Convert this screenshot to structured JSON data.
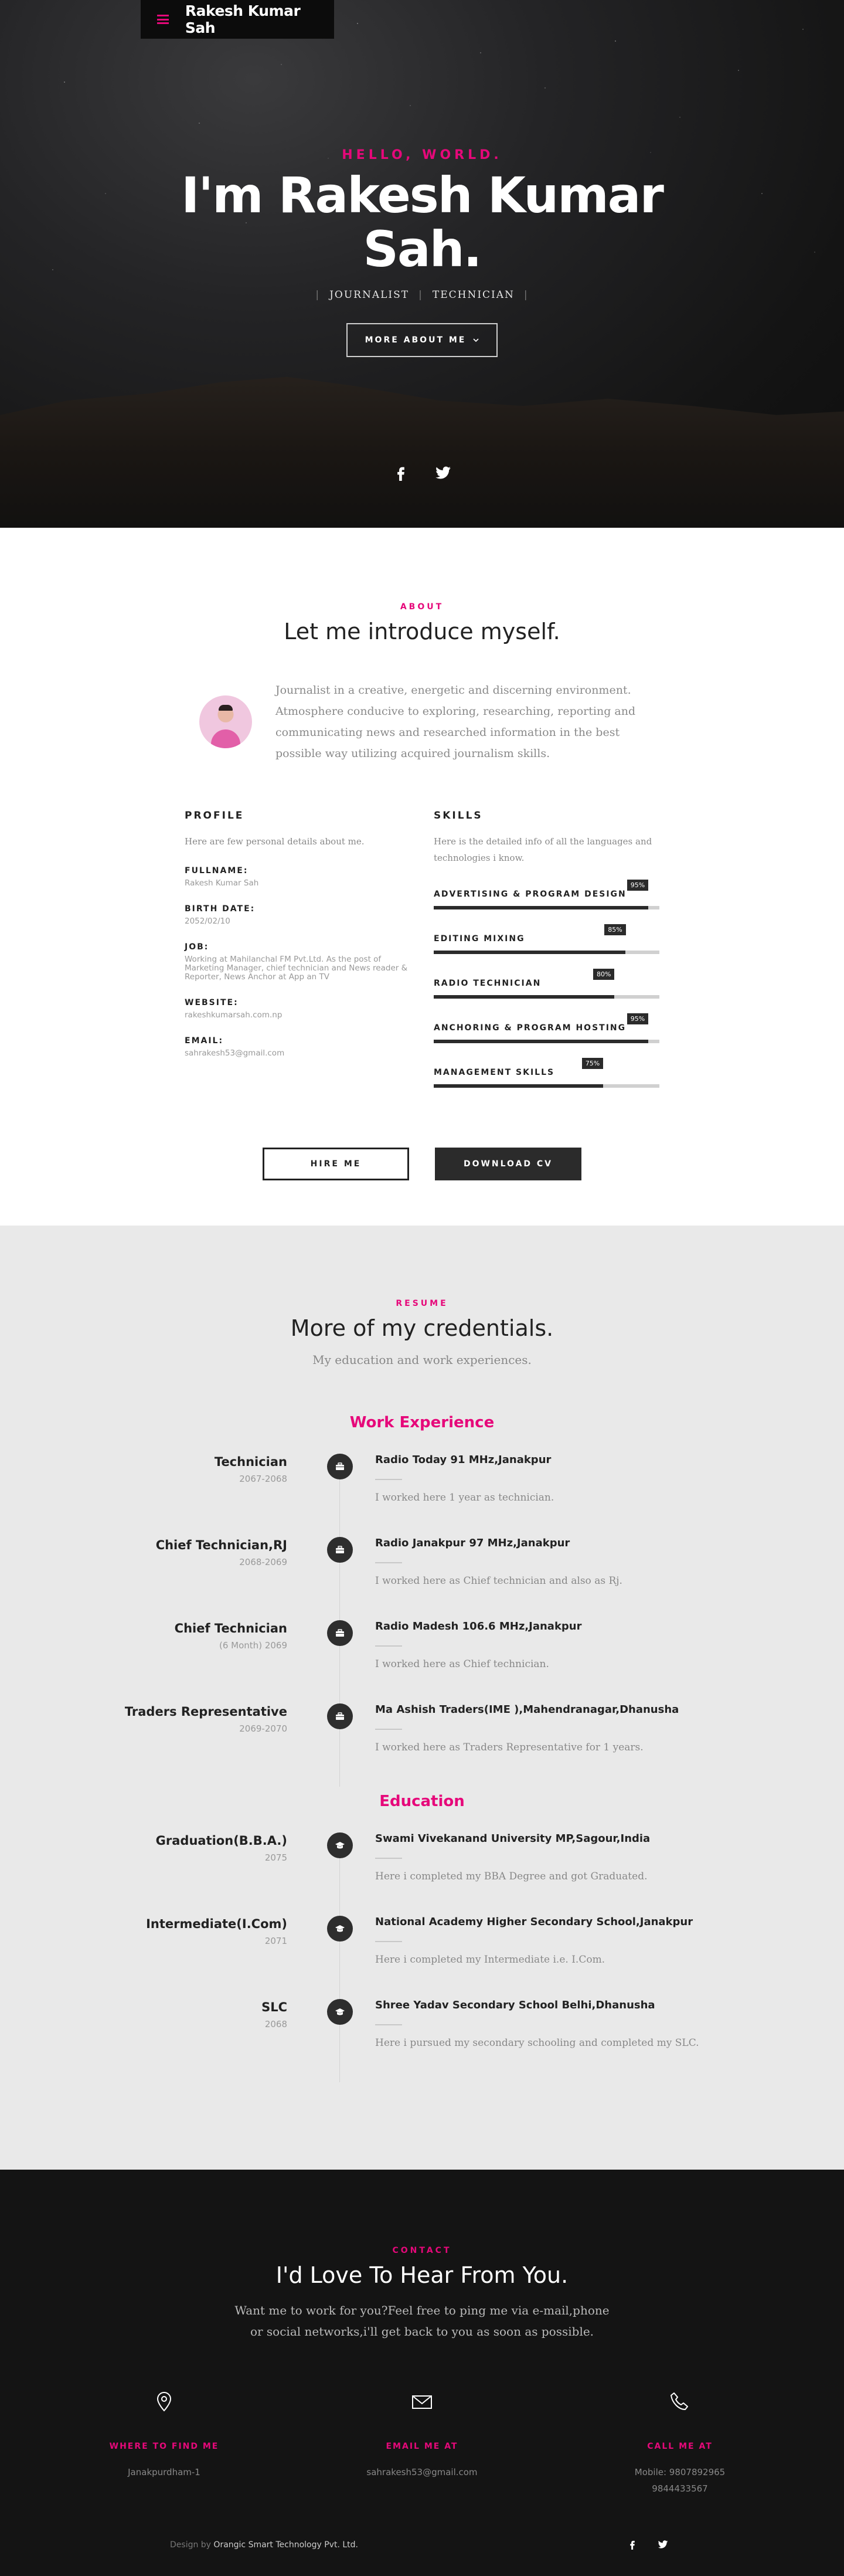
{
  "brand": {
    "name": "Rakesh Kumar Sah",
    "accent": "#e6087a"
  },
  "hero": {
    "greeting": "HELLO, WORLD.",
    "title": "I'm Rakesh Kumar Sah.",
    "roles": [
      "JOURNALIST",
      "TECHNICIAN"
    ],
    "more_button": "MORE ABOUT ME",
    "social": [
      "facebook-icon",
      "twitter-icon"
    ]
  },
  "about": {
    "kicker": "ABOUT",
    "title": "Let me introduce myself.",
    "lead": "Journalist in a creative, energetic and discerning environment. Atmosphere conducive to exploring, researching, reporting and communicating news and researched information in the best possible way utilizing acquired journalism skills.",
    "profile": {
      "title": "PROFILE",
      "desc": "Here are few personal details about me.",
      "items": [
        {
          "label": "FULLNAME:",
          "value": "Rakesh Kumar Sah"
        },
        {
          "label": "BIRTH DATE:",
          "value": "2052/02/10"
        },
        {
          "label": "JOB:",
          "value": "Working at Mahilanchal FM Pvt.Ltd. As the post of Marketing Manager, chief technician and News reader & Reporter, News Anchor at App an TV"
        },
        {
          "label": "WEBSITE:",
          "value": "rakeshkumarsah.com.np"
        },
        {
          "label": "EMAIL:",
          "value": "sahrakesh53@gmail.com"
        }
      ]
    },
    "skills": {
      "title": "SKILLS",
      "desc": "Here is the detailed info of all the languages and technologies i know.",
      "items": [
        {
          "label": "ADVERTISING & PROGRAM DESIGN",
          "percent": 95,
          "percent_label": "95%"
        },
        {
          "label": "EDITING MIXING",
          "percent": 85,
          "percent_label": "85%"
        },
        {
          "label": "RADIO TECHNICIAN",
          "percent": 80,
          "percent_label": "80%"
        },
        {
          "label": "ANCHORING & PROGRAM HOSTING",
          "percent": 95,
          "percent_label": "95%"
        },
        {
          "label": "MANAGEMENT SKILLS",
          "percent": 75,
          "percent_label": "75%"
        }
      ]
    },
    "hire_button": "HIRE ME",
    "cv_button": "DOWNLOAD CV"
  },
  "resume": {
    "kicker": "RESUME",
    "title": "More of my credentials.",
    "subtitle": "My education and work experiences.",
    "work_heading": "Work Experience",
    "work": [
      {
        "title": "Technician",
        "date": "2067-2068",
        "org": "Radio Today 91 MHz,Janakpur",
        "desc": "I worked here 1 year as technician."
      },
      {
        "title": "Chief Technician,RJ",
        "date": "2068-2069",
        "org": "Radio Janakpur 97 MHz,Janakpur",
        "desc": "I worked here as Chief technician and also as Rj."
      },
      {
        "title": "Chief Technician",
        "date": "(6 Month) 2069",
        "org": "Radio Madesh 106.6 MHz,Janakpur",
        "desc": "I worked here as Chief technician."
      },
      {
        "title": "Traders Representative",
        "date": "2069-2070",
        "org": "Ma Ashish Traders(IME ),Mahendranagar,Dhanusha",
        "desc": "I worked here as Traders Representative for 1 years."
      }
    ],
    "edu_heading": "Education",
    "education": [
      {
        "title": "Graduation(B.B.A.)",
        "date": "2075",
        "org": "Swami Vivekanand University MP,Sagour,India",
        "desc": "Here i completed my BBA Degree and got Graduated."
      },
      {
        "title": "Intermediate(I.Com)",
        "date": "2071",
        "org": "National Academy Higher Secondary School,Janakpur",
        "desc": "Here i completed my Intermediate i.e. I.Com."
      },
      {
        "title": "SLC",
        "date": "2068",
        "org": "Shree Yadav Secondary School Belhi,Dhanusha",
        "desc": "Here i pursued my secondary schooling and completed my SLC."
      }
    ]
  },
  "contact": {
    "kicker": "CONTACT",
    "title": "I'd Love To Hear From You.",
    "lead": "Want me to work for you?Feel free to ping me via e-mail,phone or social networks,i'll get back to you as soon as possible.",
    "find": {
      "title": "WHERE TO FIND ME",
      "value": "Janakpurdham-1"
    },
    "email": {
      "title": "EMAIL ME AT",
      "value": "sahrakesh53@gmail.com"
    },
    "call": {
      "title": "CALL ME AT",
      "line1": "Mobile: 9807892965",
      "line2": "9844433567"
    }
  },
  "footer": {
    "credit_prefix": "Design by",
    "credit_brand": "Orangic Smart Technology Pvt. Ltd."
  }
}
